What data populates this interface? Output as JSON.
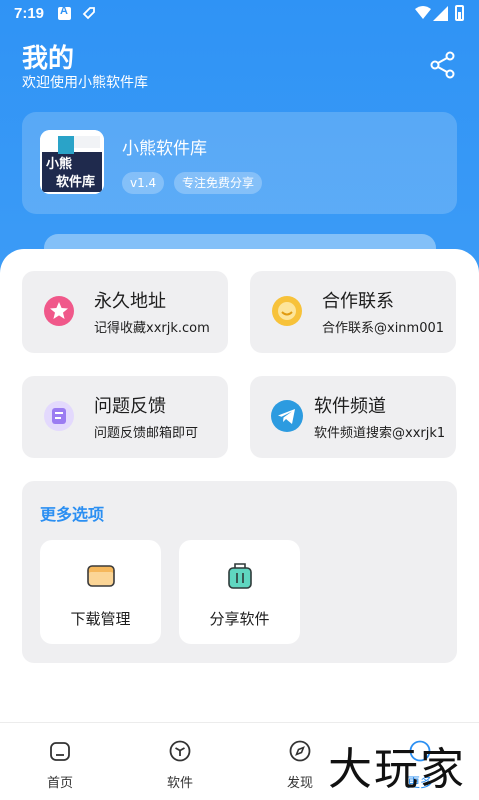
{
  "status": {
    "time": "7:19"
  },
  "header": {
    "title": "我的",
    "subtitle": "欢迎使用小熊软件库",
    "share_icon": "share-icon"
  },
  "app": {
    "logo_text_top": "小熊",
    "logo_text_bottom": "软件库",
    "name": "小熊软件库",
    "version": "v1.4",
    "slogan": "专注免费分享"
  },
  "tiles": [
    {
      "title": "永久地址",
      "desc": "记得收藏xxrjk.com",
      "icon": "star-icon",
      "color": "#f0588a"
    },
    {
      "title": "合作联系",
      "desc": "合作联系@xinm001",
      "icon": "smile-icon",
      "color": "#f7c23a"
    },
    {
      "title": "问题反馈",
      "desc": "问题反馈邮箱即可",
      "icon": "feedback-icon",
      "color": "#9b7cf2"
    },
    {
      "title": "软件频道",
      "desc": "软件频道搜索@xxrjk1",
      "icon": "telegram-icon",
      "color": "#2c9be0"
    }
  ],
  "more": {
    "title": "更多选项",
    "items": [
      {
        "label": "下载管理",
        "icon": "folder-icon"
      },
      {
        "label": "分享软件",
        "icon": "bag-icon"
      }
    ]
  },
  "nav": [
    {
      "label": "首页",
      "icon": "home-icon"
    },
    {
      "label": "软件",
      "icon": "cube-icon"
    },
    {
      "label": "发现",
      "icon": "compass-icon"
    },
    {
      "label": "更多",
      "icon": "more-icon"
    }
  ],
  "watermark": "大玩家",
  "colors": {
    "primary": "#2b8ff2",
    "tile_bg": "#efeff1"
  }
}
